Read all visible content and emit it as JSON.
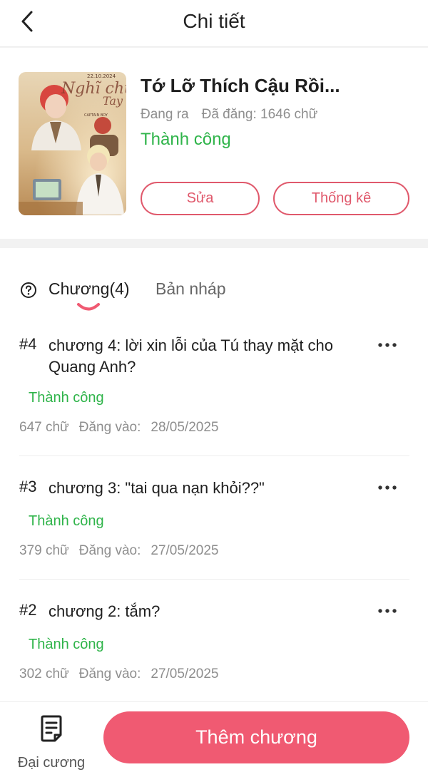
{
  "header": {
    "title": "Chi tiết",
    "back_icon": "chevron-left-icon"
  },
  "book": {
    "title": "Tớ Lỡ Thích Cậu Rồi...",
    "state": "Đang ra",
    "words_posted": "Đã đăng: 1646 chữ",
    "status": "Thành công",
    "edit_label": "Sửa",
    "stats_label": "Thống kê",
    "cover": {
      "date_text": "22.10.2024",
      "script_line1": "Nghĩ chưa",
      "script_line2": "Tay",
      "small_text": "CAPTAIN BOY"
    }
  },
  "tabs": [
    {
      "label": "Chương(4)",
      "active": true
    },
    {
      "label": "Bản nháp",
      "active": false
    }
  ],
  "chapters": [
    {
      "number": "#4",
      "title": "chương 4: lời xin lỗi của Tú thay mặt cho Quang Anh?",
      "status": "Thành công",
      "words": "647 chữ",
      "posted_label": "Đăng vào:",
      "date": "28/05/2025"
    },
    {
      "number": "#3",
      "title": "chương 3: \"tai qua nạn khỏi??\"",
      "status": "Thành công",
      "words": "379 chữ",
      "posted_label": "Đăng vào:",
      "date": "27/05/2025"
    },
    {
      "number": "#2",
      "title": "chương 2: tắm?",
      "status": "Thành công",
      "words": "302 chữ",
      "posted_label": "Đăng vào:",
      "date": "27/05/2025"
    }
  ],
  "bottom": {
    "outline_label": "Đại cương",
    "add_chapter_label": "Thêm chương"
  },
  "colors": {
    "accent": "#f05a72",
    "success": "#2fb44a",
    "muted": "#8e8e8e"
  }
}
